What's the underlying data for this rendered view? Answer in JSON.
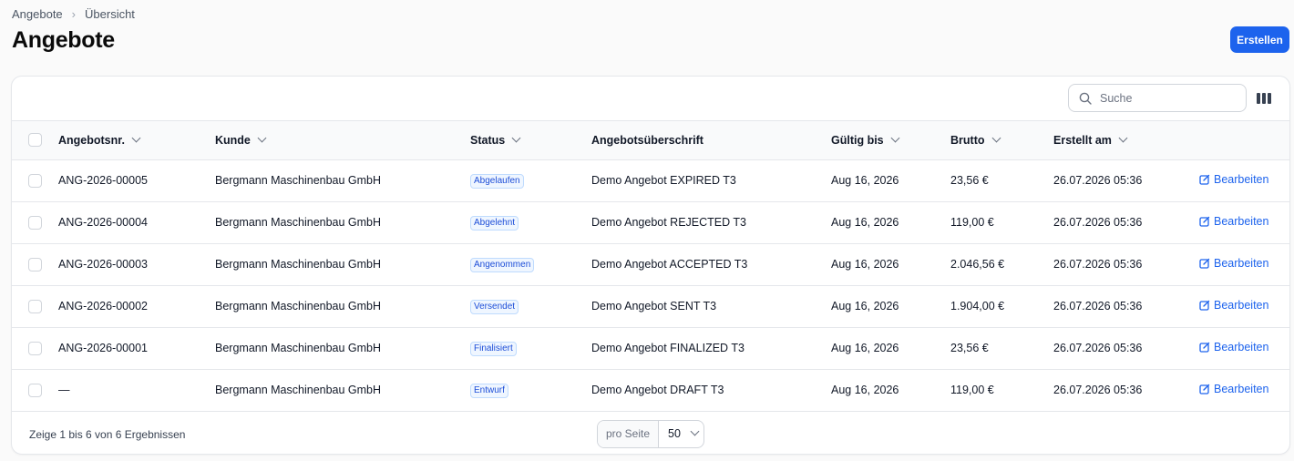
{
  "breadcrumb": {
    "items": [
      "Angebote",
      "Übersicht"
    ]
  },
  "page": {
    "title": "Angebote",
    "create_label": "Erstellen"
  },
  "toolbar": {
    "search_placeholder": "Suche",
    "columns_icon": "columns-icon"
  },
  "table": {
    "columns": [
      "Angebotsnr.",
      "Kunde",
      "Status",
      "Angebotsüberschrift",
      "Gültig bis",
      "Brutto",
      "Erstellt am"
    ],
    "edit_label": "Bearbeiten",
    "rows": [
      {
        "number": "ANG-2026-00005",
        "customer": "Bergmann Maschinenbau GmbH",
        "status": "Abgelaufen",
        "title": "Demo Angebot EXPIRED T3",
        "valid_until": "Aug 16, 2026",
        "gross": "23,56 €",
        "created": "26.07.2026 05:36"
      },
      {
        "number": "ANG-2026-00004",
        "customer": "Bergmann Maschinenbau GmbH",
        "status": "Abgelehnt",
        "title": "Demo Angebot REJECTED T3",
        "valid_until": "Aug 16, 2026",
        "gross": "119,00 €",
        "created": "26.07.2026 05:36"
      },
      {
        "number": "ANG-2026-00003",
        "customer": "Bergmann Maschinenbau GmbH",
        "status": "Angenommen",
        "title": "Demo Angebot ACCEPTED T3",
        "valid_until": "Aug 16, 2026",
        "gross": "2.046,56 €",
        "created": "26.07.2026 05:36"
      },
      {
        "number": "ANG-2026-00002",
        "customer": "Bergmann Maschinenbau GmbH",
        "status": "Versendet",
        "title": "Demo Angebot SENT T3",
        "valid_until": "Aug 16, 2026",
        "gross": "1.904,00 €",
        "created": "26.07.2026 05:36"
      },
      {
        "number": "ANG-2026-00001",
        "customer": "Bergmann Maschinenbau GmbH",
        "status": "Finalisiert",
        "title": "Demo Angebot FINALIZED T3",
        "valid_until": "Aug 16, 2026",
        "gross": "23,56 €",
        "created": "26.07.2026 05:36"
      },
      {
        "number": "—",
        "customer": "Bergmann Maschinenbau GmbH",
        "status": "Entwurf",
        "title": "Demo Angebot DRAFT T3",
        "valid_until": "Aug 16, 2026",
        "gross": "119,00 €",
        "created": "26.07.2026 05:36"
      }
    ]
  },
  "footer": {
    "results_text": "Zeige 1 bis 6 von 6 Ergebnissen",
    "per_page_label": "pro Seite",
    "per_page_value": "50"
  },
  "colors": {
    "accent": "#1d63ed",
    "badge_text": "#1d4ed8",
    "badge_bg": "#eff6ff"
  }
}
